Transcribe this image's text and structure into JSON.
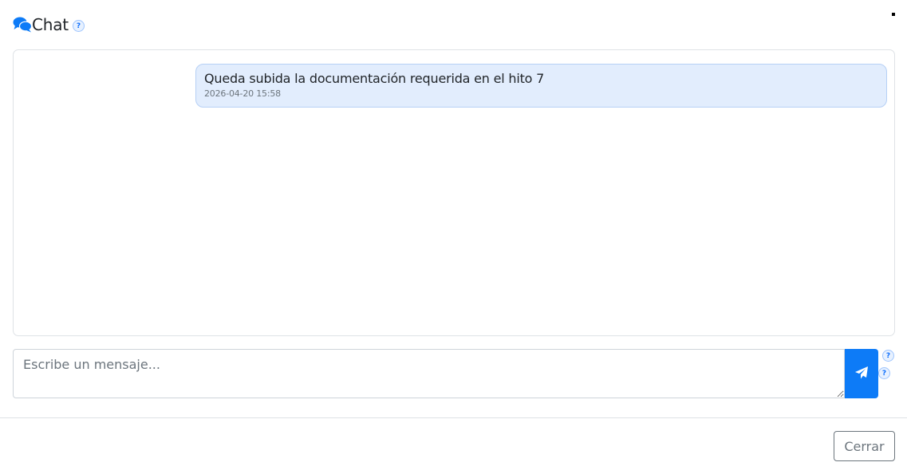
{
  "header": {
    "title": "Chat",
    "help": "?"
  },
  "messages": [
    {
      "text": "Queda subida la documentación requerida en el hito 7",
      "timestamp": "2026-04-20 15:58"
    }
  ],
  "composer": {
    "placeholder": "Escribe un mensaje...",
    "value": "",
    "help_top": "?",
    "help_bottom": "?"
  },
  "footer": {
    "close_label": "Cerrar"
  },
  "colors": {
    "accent": "#0d7bf7",
    "bubble_bg": "#e2edfd",
    "bubble_border": "#b6d0f5"
  },
  "icons": {
    "header": "comments-icon",
    "send": "paper-plane-icon"
  }
}
